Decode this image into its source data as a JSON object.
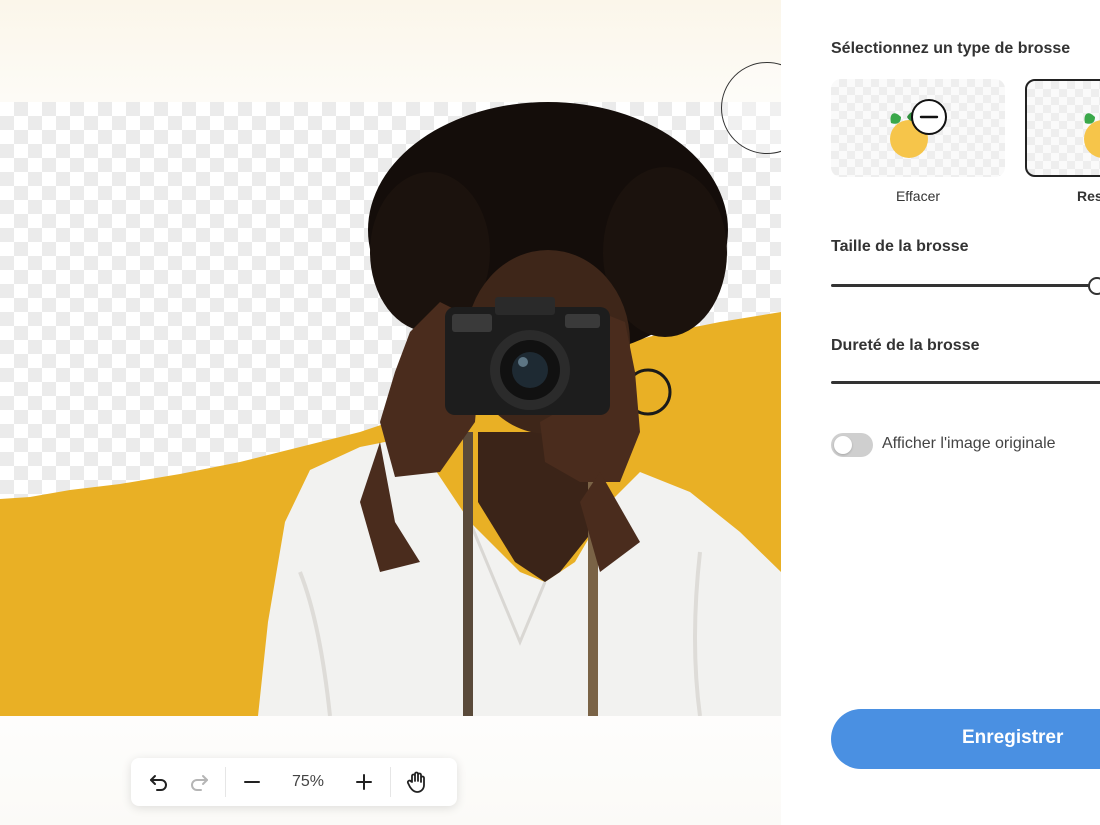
{
  "editor": {
    "zoom": "75%",
    "colors": {
      "accent_yellow": "#e9b025",
      "checker": "#ebebeb"
    }
  },
  "toolbar": {
    "undo_icon": "undo-icon",
    "redo_icon": "redo-icon",
    "zoom_out_icon": "minus-icon",
    "zoom_in_icon": "plus-icon",
    "pan_icon": "hand-icon"
  },
  "panel": {
    "title": "Sélectionnez un type de brosse",
    "brushes": [
      {
        "label": "Effacer",
        "icon": "orange-minus-icon",
        "selected": false
      },
      {
        "label": "Restaurer",
        "icon": "orange-plus-icon",
        "selected": true
      }
    ],
    "brush_size_label": "Taille de la brosse",
    "brush_size_value": 0.95,
    "brush_hardness_label": "Dureté de la brosse",
    "brush_hardness_value": 1.0,
    "show_original_label": "Afficher l'image originale",
    "show_original_on": false,
    "save_label": "Enregistrer",
    "colors": {
      "save_button": "#4a90e2"
    }
  }
}
